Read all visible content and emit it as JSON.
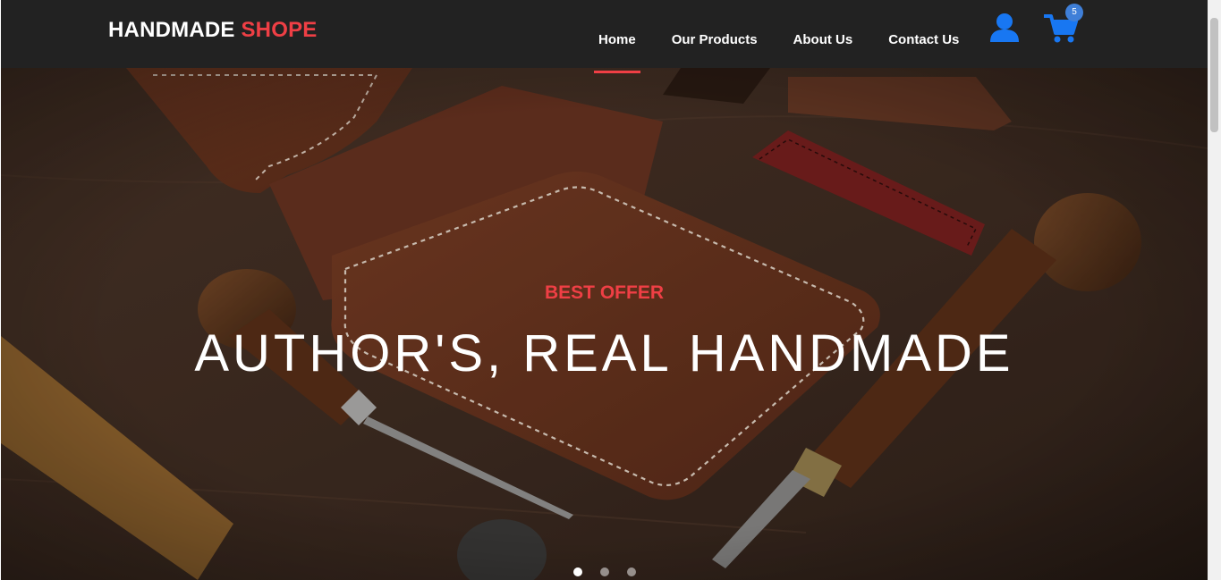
{
  "brand": {
    "name": "HANDMADE",
    "accent": "SHOPE"
  },
  "nav": {
    "links": [
      {
        "label": "Home",
        "active": true
      },
      {
        "label": "Our Products",
        "active": false
      },
      {
        "label": "About Us",
        "active": false
      },
      {
        "label": "Contact Us",
        "active": false
      }
    ],
    "user_icon": "user-icon",
    "cart_icon": "shopping-cart-icon",
    "cart_count": "5"
  },
  "hero": {
    "subtitle": "BEST OFFER",
    "title": "AUTHOR'S, REAL HANDMADE",
    "slides_total": 3,
    "active_slide": 1
  },
  "colors": {
    "navbar": "#222222",
    "accent": "#ef3f45",
    "icon_blue": "#1877f2",
    "badge": "#3f7fd8"
  }
}
